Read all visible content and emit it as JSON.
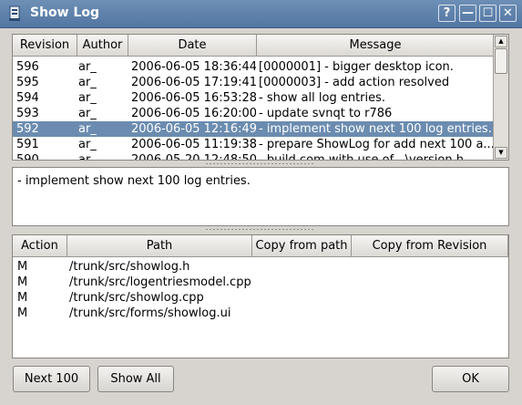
{
  "window": {
    "title": "Show Log",
    "help_glyph": "?",
    "min_glyph": "—",
    "max_glyph": "☐",
    "close_glyph": "✕"
  },
  "log": {
    "columns": [
      "Revision",
      "Author",
      "Date",
      "Message"
    ],
    "rows": [
      {
        "rev": "596",
        "author": "ar_",
        "date": "2006-06-05 18:36:44",
        "msg": "[0000001] - bigger desktop icon.",
        "selected": false
      },
      {
        "rev": "595",
        "author": "ar_",
        "date": "2006-06-05 17:19:41",
        "msg": "[0000003] - add action resolved",
        "selected": false
      },
      {
        "rev": "594",
        "author": "ar_",
        "date": "2006-06-05 16:53:28",
        "msg": "- show all log entries.",
        "selected": false
      },
      {
        "rev": "593",
        "author": "ar_",
        "date": "2006-06-05 16:20:00",
        "msg": "- update svnqt to r786",
        "selected": false
      },
      {
        "rev": "592",
        "author": "ar_",
        "date": "2006-06-05 12:16:49",
        "msg": "- implement show next 100 log entries.",
        "selected": true
      },
      {
        "rev": "591",
        "author": "ar_",
        "date": "2006-06-05 11:19:38",
        "msg": "- prepare ShowLog for add next 100 a...",
        "selected": false
      },
      {
        "rev": "590",
        "author": "ar_",
        "date": "2006-05-20 12:48:50",
        "msg": "- build.com with use of ..\\version.h",
        "selected": false
      }
    ]
  },
  "message": {
    "text": "- implement show next 100 log entries."
  },
  "paths": {
    "columns": [
      "Action",
      "Path",
      "Copy from path",
      "Copy from Revision"
    ],
    "rows": [
      {
        "action": "M",
        "path": "/trunk/src/showlog.h"
      },
      {
        "action": "M",
        "path": "/trunk/src/logentriesmodel.cpp"
      },
      {
        "action": "M",
        "path": "/trunk/src/showlog.cpp"
      },
      {
        "action": "M",
        "path": "/trunk/src/forms/showlog.ui"
      }
    ]
  },
  "buttons": {
    "next100": "Next 100",
    "showall": "Show All",
    "ok": "OK"
  },
  "icons": {
    "app": "app-icon",
    "up": "up-arrow-icon",
    "down": "down-arrow-icon"
  }
}
